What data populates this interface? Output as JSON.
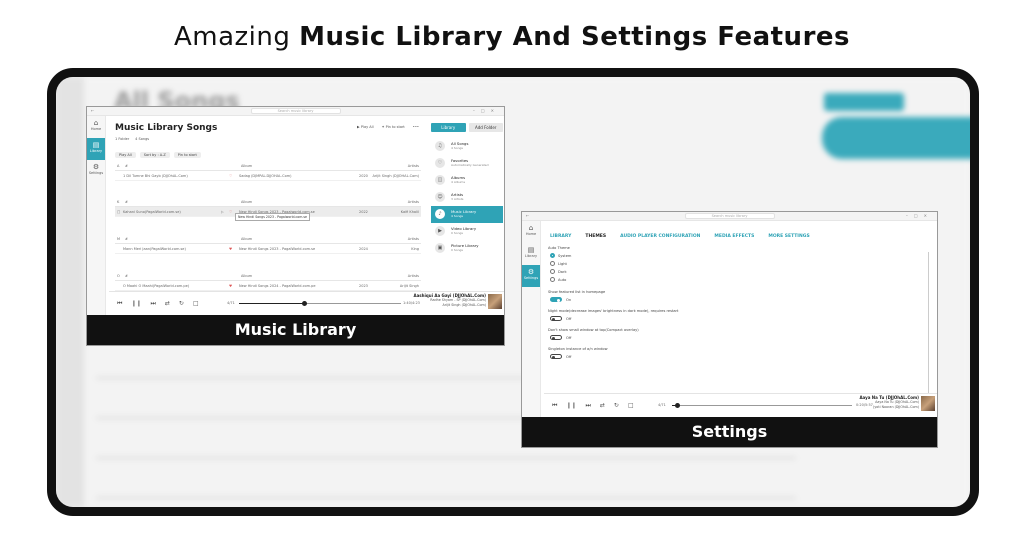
{
  "headline": {
    "light": "Amazing",
    "bold": "Music Library And Settings Features"
  },
  "background": {
    "title": "All Songs"
  },
  "library_window": {
    "search_placeholder": "Search music library",
    "nav": [
      {
        "label": "Home",
        "icon": "home-icon"
      },
      {
        "label": "Library",
        "icon": "library-icon",
        "active": true
      },
      {
        "label": "Settings",
        "icon": "gear-icon"
      }
    ],
    "title": "Music Library Songs",
    "actions": {
      "play_all": "Play All",
      "pin_to_start": "Pin to start"
    },
    "meta": {
      "folders": "1 Folder",
      "songs": "4 Songs"
    },
    "tools": {
      "play_all": "Play All",
      "sort": "Sort by : A-Z",
      "pin": "Pin to start"
    },
    "table_headers": {
      "num": "#",
      "album": "Album",
      "artist": "Artists"
    },
    "groups": [
      {
        "letter": "A",
        "song": "1  Dil Tumne Bhi Gayb (DJJOhAL.Com)",
        "album": "Sadag (DJMPAL.DJJOHAL.Com)",
        "year": "2020",
        "artist": "Arijit Singh (DJJOHAL.Com)"
      },
      {
        "letter": "K",
        "song": "Kahani Suno(PagalWorld.com.se)",
        "album": "New Hindi Songs 2023 - Pagalworld.com.se",
        "year": "2022",
        "artist": "Kaifi Khalil",
        "highlight": true
      },
      {
        "letter": "M",
        "song": "Mann Meri Jaan(PagalWorld.com.se)",
        "album": "New Hindi Songs 2023 - PagalWorld.com.se",
        "year": "2024",
        "artist": "King"
      },
      {
        "letter": "O",
        "song": "O Maahi O Maahi(PagalWorld.com.pe)",
        "album": "New Hindi Songs 2024 - PagalWorld.com.pe",
        "year": "2023",
        "artist": "Arijit Singh"
      }
    ],
    "tooltip": "New Hindi Songs 2023 - Pagalworld.com.se",
    "tabs": {
      "library": "Library",
      "add_folder": "Add Folder"
    },
    "right_items": [
      {
        "title": "All Songs",
        "sub": "4 Songs",
        "icon": "music-notes-icon"
      },
      {
        "title": "Favorites",
        "sub": "Automatically Generated",
        "icon": "heart-icon"
      },
      {
        "title": "Albums",
        "sub": "4 Albums",
        "icon": "album-icon"
      },
      {
        "title": "Artists",
        "sub": "3 Artists",
        "icon": "artist-icon"
      },
      {
        "title": "Music Library",
        "sub": "4 Songs",
        "icon": "music-library-icon",
        "active": true
      },
      {
        "title": "Video Library",
        "sub": "0 Songs",
        "icon": "video-icon"
      },
      {
        "title": "Picture Library",
        "sub": "0 Songs",
        "icon": "picture-icon"
      }
    ],
    "player": {
      "elapsed": "4/71",
      "duration": "1:40/4:23",
      "track": "Aashiqui Aa Gayi (DJJOhAL.Com)",
      "line2": "Radhe Shyam - SP (DJJOhAL.Com)",
      "line3": "Arijit Singh (DJJOhAL.Com)",
      "progress": 0.4
    },
    "caption": "Music Library"
  },
  "settings_window": {
    "search_placeholder": "Search music library",
    "nav": [
      {
        "label": "Home",
        "icon": "home-icon"
      },
      {
        "label": "Library",
        "icon": "library-icon"
      },
      {
        "label": "Settings",
        "icon": "gear-icon",
        "active": true
      }
    ],
    "tabs": [
      "LIBRARY",
      "THEMES",
      "AUDIO PLAYER CONFIGURATION",
      "MEDIA EFFECTS",
      "MORE SETTINGS"
    ],
    "auto_theme_label": "Auto Theme",
    "theme_options": [
      "System",
      "Light",
      "Dark",
      "Auto"
    ],
    "toggles": [
      {
        "label": "Show featured list in homepage",
        "state": "On",
        "on": true
      },
      {
        "label": "Night mode(decrease images' brightness in dark mode), requires restart",
        "state": "Off",
        "on": false
      },
      {
        "label": "Don't show small window at top(Compact overlay)",
        "state": "Off",
        "on": false
      },
      {
        "label": "Singleton instance of a/n window",
        "state": "Off",
        "on": false
      }
    ],
    "player": {
      "elapsed": "4/71",
      "duration": "0:20/5:57",
      "track": "Aaya Na Tu (DJJOhAL.Com)",
      "line2": "Aaya Na Tu (DJJOhAL.Com)",
      "line3": "Jyoti Nooran (DJJOhAL.Com)",
      "progress": 0.03
    },
    "caption": "Settings"
  }
}
